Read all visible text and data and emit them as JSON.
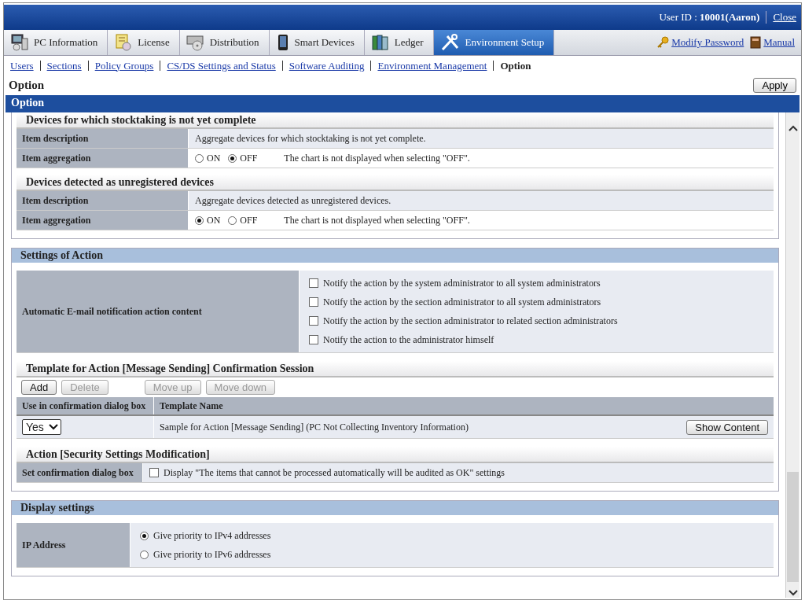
{
  "header": {
    "user_id": "User ID : **10001(Aaron)**",
    "close_link": "Close"
  },
  "tabs": [
    {
      "label": "PC Information",
      "selected": false
    },
    {
      "label": "License",
      "selected": false
    },
    {
      "label": "Distribution",
      "selected": false
    },
    {
      "label": "Smart Devices",
      "selected": false
    },
    {
      "label": "Ledger",
      "selected": false
    },
    {
      "label": "Environment Setup",
      "selected": true
    }
  ],
  "header_links": [
    "Modify Password",
    "Manual"
  ],
  "subnav": [
    {
      "label": "Users",
      "selected": false
    },
    {
      "label": "Sections",
      "selected": false
    },
    {
      "label": "Policy Groups",
      "selected": false
    },
    {
      "label": "CS/DS Settings and Status",
      "selected": false
    },
    {
      "label": "Software Auditing",
      "selected": false
    },
    {
      "label": "Environment Management",
      "selected": false
    },
    {
      "label": "Option",
      "selected": true
    }
  ],
  "page_title": "Option",
  "apply_button": "Apply",
  "panel_title": "Option",
  "aggregation_groups": [
    {
      "title": "Devices for which stocktaking is not yet complete",
      "rows": [
        {
          "kind": "text",
          "label": "Item description",
          "value": "Aggregate devices for which stocktaking is not yet complete."
        },
        {
          "kind": "radio",
          "label": "Item aggregation",
          "options": [
            {
              "label": "ON",
              "selected": false
            },
            {
              "label": "OFF",
              "selected": true
            }
          ],
          "note": "The chart is not displayed when selecting \"OFF\"."
        }
      ]
    },
    {
      "title": "Devices detected as unregistered devices",
      "rows": [
        {
          "kind": "text",
          "label": "Item description",
          "value": "Aggregate devices detected as unregistered devices."
        },
        {
          "kind": "radio",
          "label": "Item aggregation",
          "options": [
            {
              "label": "ON",
              "selected": true
            },
            {
              "label": "OFF",
              "selected": false
            }
          ],
          "note": "The chart is not displayed when selecting \"OFF\"."
        }
      ]
    }
  ],
  "action_settings": {
    "title": "Settings of Action",
    "notification": {
      "label": "Automatic E-mail notification action content",
      "options": [
        {
          "label": "Notify the action by the system administrator to all system administrators",
          "checked": false
        },
        {
          "label": "Notify the action by the section administrator to all system administrators",
          "checked": false
        },
        {
          "label": "Notify the action by the section administrator to related section administrators",
          "checked": false
        },
        {
          "label": "Notify the action to the administrator himself",
          "checked": false
        }
      ]
    },
    "template": {
      "title": "Template for Action [Message Sending] Confirmation Session",
      "buttons": [
        {
          "label": "Add",
          "disabled": false
        },
        {
          "label": "Delete",
          "disabled": true
        },
        {
          "label": "Move up",
          "disabled": true
        },
        {
          "label": "Move down",
          "disabled": true
        }
      ],
      "columns": [
        "Use in confirmation dialog box",
        "Template Name"
      ],
      "rows": [
        {
          "use": "Yes",
          "name": "Sample for Action [Message Sending] (PC Not Collecting Inventory Information)",
          "button": "Show Content"
        }
      ]
    },
    "security": {
      "title": "Action [Security Settings Modification]",
      "label": "Set confirmation dialog box",
      "option": {
        "label": "Display \"The items that cannot be processed automatically will be audited as OK\" settings",
        "checked": false
      }
    }
  },
  "display_settings": {
    "title": "Display settings",
    "ip": {
      "label": "IP Address",
      "options": [
        {
          "label": "Give priority to IPv4 addresses",
          "selected": true
        },
        {
          "label": "Give priority to IPv6 addresses",
          "selected": false
        }
      ]
    }
  }
}
